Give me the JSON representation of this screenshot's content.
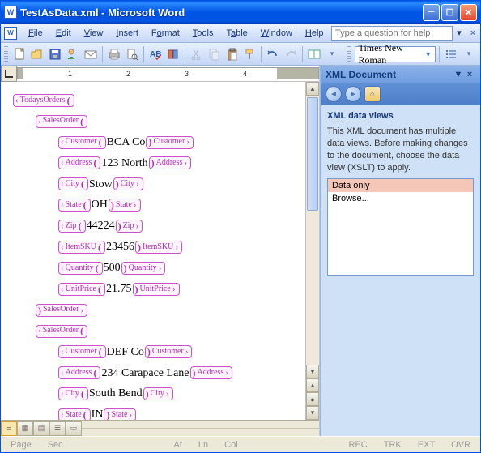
{
  "window": {
    "title": "TestAsData.xml - Microsoft Word"
  },
  "menus": {
    "file": "File",
    "edit": "Edit",
    "view": "View",
    "insert": "Insert",
    "format": "Format",
    "tools": "Tools",
    "table": "Table",
    "window": "Window",
    "help": "Help",
    "help_placeholder": "Type a question for help"
  },
  "toolbar": {
    "font": "Times New Roman"
  },
  "xml": {
    "root": "TodaysOrders",
    "orders": [
      {
        "label": "SalesOrder",
        "fields": [
          {
            "tag": "Customer",
            "val": "BCA Co"
          },
          {
            "tag": "Address",
            "val": "123 North"
          },
          {
            "tag": "City",
            "val": "Stow"
          },
          {
            "tag": "State",
            "val": "OH"
          },
          {
            "tag": "Zip",
            "val": "44224"
          },
          {
            "tag": "ItemSKU",
            "val": "23456"
          },
          {
            "tag": "Quantity",
            "val": "500"
          },
          {
            "tag": "UnitPrice",
            "val": "21.75"
          }
        ]
      },
      {
        "label": "SalesOrder",
        "closing": true
      },
      {
        "label": "SalesOrder",
        "fields": [
          {
            "tag": "Customer",
            "val": "DEF Co"
          },
          {
            "tag": "Address",
            "val": "234 Carapace Lane"
          },
          {
            "tag": "City",
            "val": "South Bend"
          },
          {
            "tag": "State",
            "val": "IN"
          }
        ]
      }
    ]
  },
  "pane": {
    "title": "XML Document",
    "section_title": "XML data views",
    "desc": "This XML document has multiple data views. Before making changes to the document, choose the data view (XSLT) to apply.",
    "items": [
      "Data only",
      "Browse..."
    ]
  },
  "status": {
    "page": "Page",
    "sec": "Sec",
    "at": "At",
    "ln": "Ln",
    "col": "Col",
    "rec": "REC",
    "trk": "TRK",
    "ext": "EXT",
    "ovr": "OVR"
  }
}
